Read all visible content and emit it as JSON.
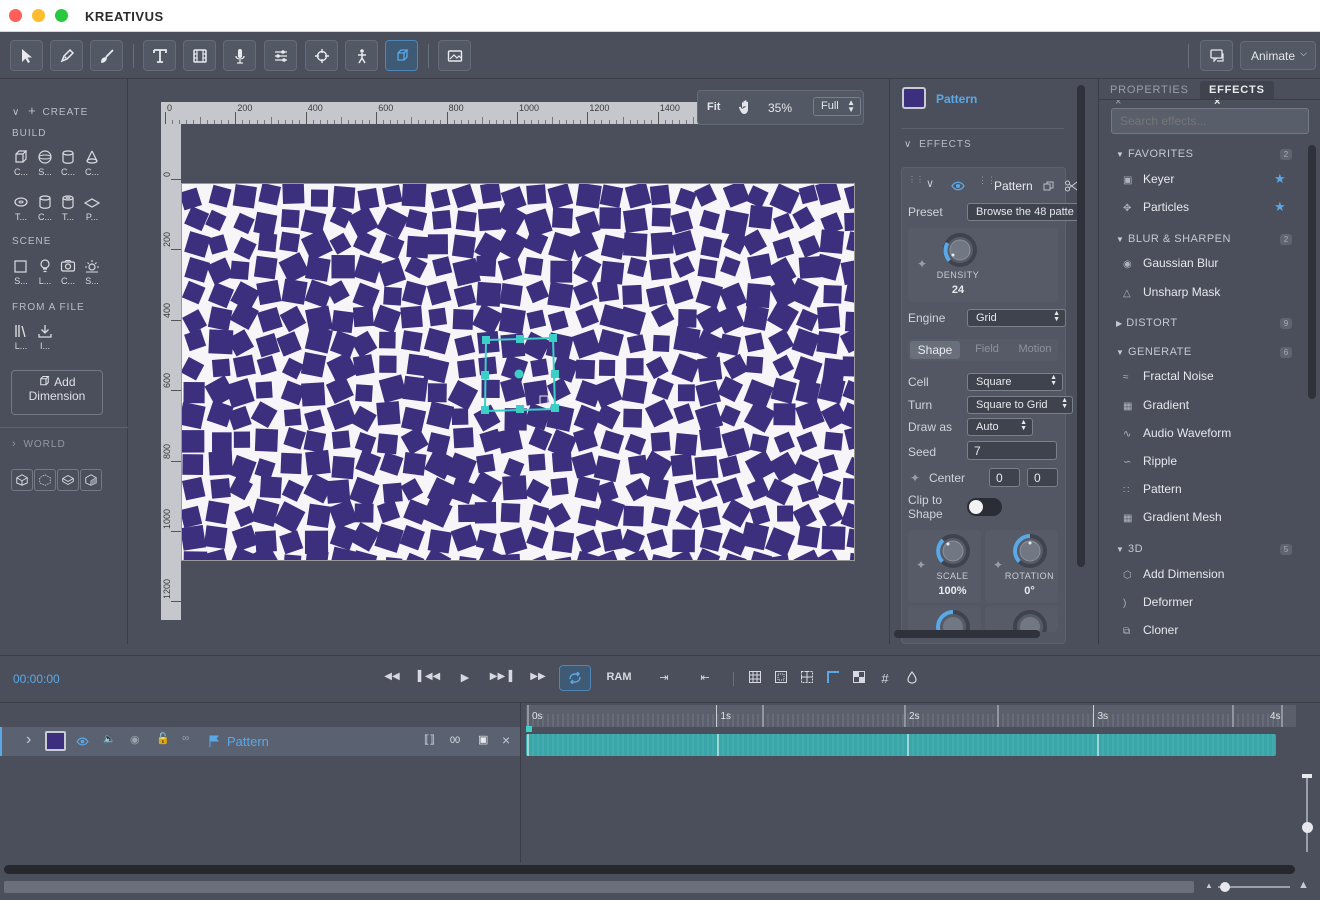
{
  "app": {
    "title": "KREATIVUS"
  },
  "toolbar": {
    "animate_label": "Animate"
  },
  "left_panel": {
    "create_label": "CREATE",
    "build_label": "BUILD",
    "build_items": [
      "C...",
      "S...",
      "C...",
      "C...",
      "T...",
      "C...",
      "T...",
      "P..."
    ],
    "scene_label": "SCENE",
    "scene_items": [
      "S...",
      "L...",
      "C...",
      "S..."
    ],
    "from_file_label": "FROM A FILE",
    "file_items": [
      "L...",
      "I..."
    ],
    "add_dimension_line1": "Add",
    "add_dimension_line2": "Dimension",
    "world_label": "WORLD"
  },
  "viewport": {
    "fit_label": "Fit",
    "zoom_value": "35%",
    "quality": "Full",
    "ruler_top_ticks": [
      "0",
      "200",
      "400",
      "600",
      "800",
      "1000",
      "1200",
      "1400"
    ],
    "ruler_left_ticks": [
      "0",
      "200",
      "400",
      "600",
      "800",
      "1000",
      "1200"
    ]
  },
  "pattern_panel": {
    "layer_name": "Pattern",
    "effects_header": "EFFECTS",
    "effect_name": "Pattern",
    "preset_label": "Preset",
    "preset_value": "Browse the 48 patte",
    "density_label": "DENSITY",
    "density_value": "24",
    "engine_label": "Engine",
    "engine_value": "Grid",
    "tabs": [
      "Shape",
      "Field",
      "Motion"
    ],
    "cell_label": "Cell",
    "cell_value": "Square",
    "turn_label": "Turn",
    "turn_value": "Square to Grid",
    "draw_as_label": "Draw as",
    "draw_as_value": "Auto",
    "seed_label": "Seed",
    "seed_value": "7",
    "center_label": "Center",
    "center_x": "0",
    "center_y": "0",
    "clip_label_line1": "Clip to",
    "clip_label_line2": "Shape",
    "scale_label": "SCALE",
    "scale_value": "100%",
    "rotation_label": "ROTATION",
    "rotation_value": "0°"
  },
  "effects_panel": {
    "tab_properties": "PROPERTIES",
    "tab_effects": "EFFECTS",
    "search_placeholder": "Search effects...",
    "categories": {
      "favorites": {
        "name": "FAVORITES",
        "count": "2",
        "items": [
          "Keyer",
          "Particles"
        ]
      },
      "blur": {
        "name": "BLUR & SHARPEN",
        "count": "2",
        "items": [
          "Gaussian Blur",
          "Unsharp Mask"
        ]
      },
      "distort": {
        "name": "DISTORT",
        "count": "9"
      },
      "generate": {
        "name": "GENERATE",
        "count": "6",
        "items": [
          "Fractal Noise",
          "Gradient",
          "Audio Waveform",
          "Ripple",
          "Pattern",
          "Gradient Mesh"
        ]
      },
      "three_d": {
        "name": "3D",
        "count": "5",
        "items": [
          "Add Dimension",
          "Deformer",
          "Cloner"
        ]
      }
    }
  },
  "timeline": {
    "timecode": "00:00:00",
    "ram_label": "RAM",
    "layer_name": "Pattern",
    "layer_badge": "00",
    "ruler_marks": [
      "0s",
      "1s",
      "2s",
      "3s",
      "4s"
    ]
  },
  "colors": {
    "accent": "#5aa8e6",
    "teal": "#3ccfc7",
    "pattern_square": "#3c2f7e",
    "clip_bar": "#3aa6a8"
  }
}
